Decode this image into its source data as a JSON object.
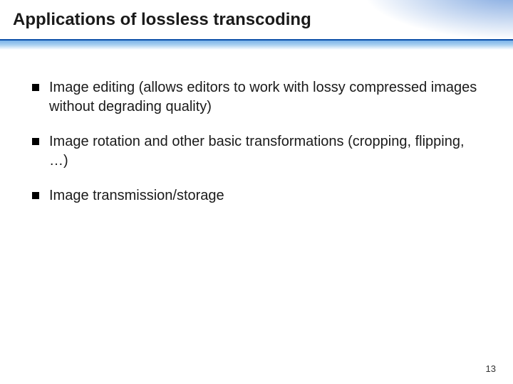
{
  "slide": {
    "title": "Applications of lossless transcoding",
    "bullets": [
      "Image editing (allows editors to work with lossy compressed images without degrading quality)",
      "Image rotation and other basic transformations (cropping, flipping, …)",
      "Image transmission/storage"
    ],
    "page_number": "13"
  }
}
